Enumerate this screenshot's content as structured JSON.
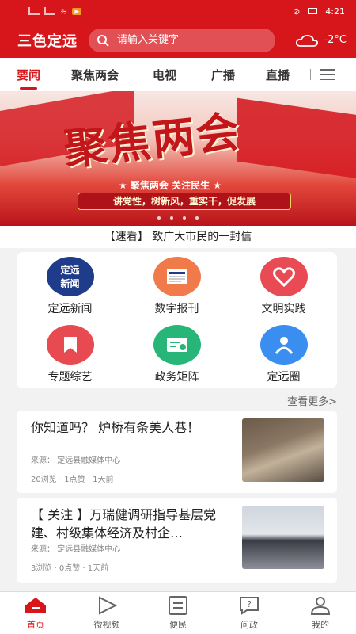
{
  "status_bar": {
    "time": "4:21"
  },
  "header": {
    "logo": "三色定远",
    "search_placeholder": "请输入关键字",
    "temperature": "-2°C",
    "weather_icon": "cloud-icon"
  },
  "tabs": [
    {
      "label": "要闻",
      "active": true
    },
    {
      "label": "聚焦两会",
      "active": false
    },
    {
      "label": "电视",
      "active": false
    },
    {
      "label": "广播",
      "active": false
    },
    {
      "label": "直播",
      "active": false
    }
  ],
  "banner": {
    "title": "聚焦两会",
    "subtitle": "★ 聚焦两会  关注民生 ★",
    "slogan": "讲党性，树新风，重实干，促发展"
  },
  "headline": "【速看】 致广大市民的一封信",
  "services": [
    {
      "label": "定远新闻",
      "icon": "dingyuan-news-icon",
      "color": "#1f3c8a"
    },
    {
      "label": "数字报刊",
      "icon": "newspaper-icon",
      "color": "#f07a4a"
    },
    {
      "label": "文明实践",
      "icon": "heart-icon",
      "color": "#e94b55"
    },
    {
      "label": "专题综艺",
      "icon": "bookmark-icon",
      "color": "#e84a52"
    },
    {
      "label": "政务矩阵",
      "icon": "government-card-icon",
      "color": "#27b677"
    },
    {
      "label": "定远圈",
      "icon": "community-icon",
      "color": "#3a8ef0"
    }
  ],
  "more_link": "查看更多>",
  "news": [
    {
      "title": "你知道吗？ 炉桥有条美人巷！",
      "source": "来源：  定远县融媒体中心",
      "meta": "20浏览 · 1点赞 · 1天前"
    },
    {
      "title": "【 关注 】万瑞健调研指导基层党建、村级集体经济及村企…",
      "source": "来源：  定远县融媒体中心",
      "meta": "3浏览 · 0点赞 · 1天前"
    }
  ],
  "bottom_nav": [
    {
      "label": "首页",
      "icon": "home-icon",
      "active": true
    },
    {
      "label": "微视频",
      "icon": "play-icon",
      "active": false
    },
    {
      "label": "便民",
      "icon": "document-icon",
      "active": false
    },
    {
      "label": "问政",
      "icon": "question-icon",
      "active": false
    },
    {
      "label": "我的",
      "icon": "user-icon",
      "active": false
    }
  ],
  "colors": {
    "brand": "#d7161b"
  }
}
